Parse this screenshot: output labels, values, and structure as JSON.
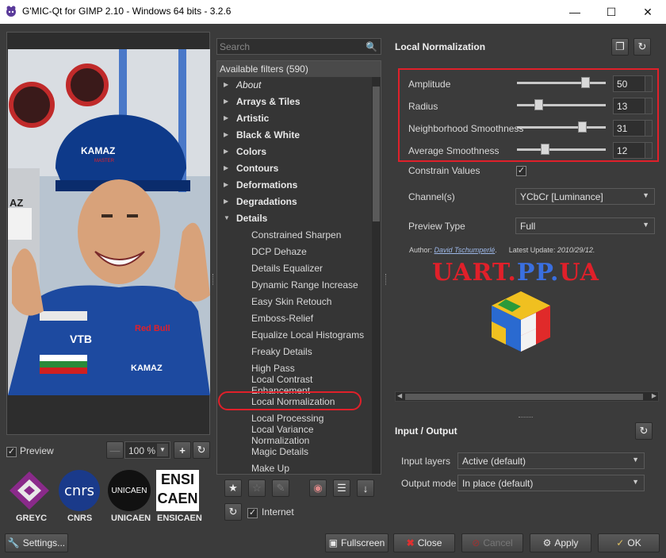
{
  "window": {
    "title": "G'MIC-Qt for GIMP 2.10 - Windows 64 bits - 3.2.6"
  },
  "preview": {
    "label": "Preview",
    "checked": true,
    "zoom": "100 %"
  },
  "logos": [
    "GREYC",
    "CNRS",
    "UNICAEN",
    "ENSICAEN"
  ],
  "logo_marks": {
    "cnrs": "cnrs",
    "unicaen": "UNICAEN",
    "ensi": "ENSI",
    "caen": "CAEN"
  },
  "photo_text": {
    "kamaz": "KAMAZ",
    "master": "MASTER",
    "vtb": "VTB",
    "redbull": "Red Bull",
    "az": "AZ"
  },
  "settings_label": "Settings...",
  "search": {
    "placeholder": "Search"
  },
  "filters": {
    "header": "Available filters (590)",
    "categories": [
      "About",
      "Arrays & Tiles",
      "Artistic",
      "Black & White",
      "Colors",
      "Contours",
      "Deformations",
      "Degradations",
      "Details"
    ],
    "details_items": [
      "Constrained Sharpen",
      "DCP Dehaze",
      "Details Equalizer",
      "Dynamic Range Increase",
      "Easy Skin Retouch",
      "Emboss-Relief",
      "Equalize Local Histograms",
      "Freaky Details",
      "High Pass",
      "Local Contrast Enhancement",
      "Local Normalization",
      "Local Processing",
      "Local Variance Normalization",
      "Magic Details",
      "Make Up"
    ],
    "selected": "Local Normalization"
  },
  "internet": {
    "label": "Internet",
    "checked": true
  },
  "filter_title": "Local Normalization",
  "params": [
    {
      "label": "Amplitude",
      "value": "50",
      "fraction": 0.8
    },
    {
      "label": "Radius",
      "value": "13",
      "fraction": 0.22
    },
    {
      "label": "Neighborhood Smoothness",
      "value": "31",
      "fraction": 0.76
    },
    {
      "label": "Average Smoothness",
      "value": "12",
      "fraction": 0.3
    }
  ],
  "constrain": {
    "label": "Constrain Values",
    "checked": true
  },
  "channels": {
    "label": "Channel(s)",
    "value": "YCbCr [Luminance]"
  },
  "preview_type": {
    "label": "Preview Type",
    "value": "Full"
  },
  "author": {
    "prefix": "Author:",
    "name": "David Tschumperlé",
    "update_label": "Latest Update:",
    "update_date": "2010/29/12"
  },
  "watermark": {
    "part1": "UART.",
    "part2": "PP.",
    "part3": "UA"
  },
  "io": {
    "title": "Input / Output",
    "input_label": "Input layers",
    "input_value": "Active (default)",
    "output_label": "Output mode",
    "output_value": "In place (default)"
  },
  "buttons": {
    "fullscreen": "Fullscreen",
    "close": "Close",
    "cancel": "Cancel",
    "apply": "Apply",
    "ok": "OK"
  },
  "colors": {
    "highlight_red": "#e0202a",
    "background": "#3b3b3b"
  }
}
